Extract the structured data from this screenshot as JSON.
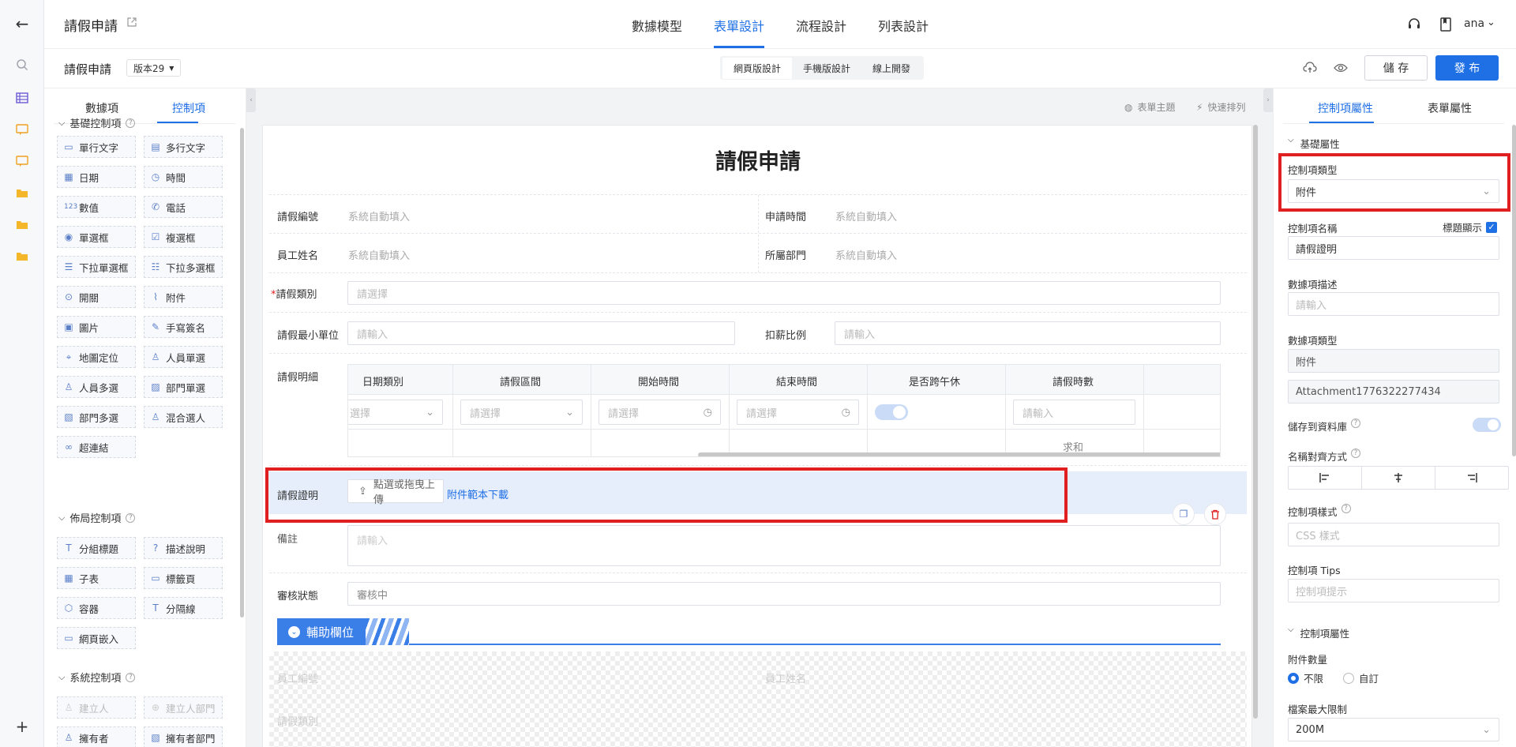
{
  "header": {
    "title": "請假申請",
    "tabs": [
      {
        "label": "數據模型"
      },
      {
        "label": "表單設計"
      },
      {
        "label": "流程設計"
      },
      {
        "label": "列表設計"
      }
    ],
    "user": "ana"
  },
  "subbar": {
    "form_name": "請假申請",
    "version": "版本29",
    "modes": [
      "網頁版設計",
      "手機版設計",
      "線上開發"
    ],
    "save": "儲 存",
    "publish": "發 布"
  },
  "left_panel": {
    "tabs": [
      "數據項",
      "控制項"
    ],
    "basic": {
      "title": "基礎控制項",
      "items": [
        "單行文字",
        "多行文字",
        "日期",
        "時間",
        "數值",
        "電話",
        "單選框",
        "複選框",
        "下拉單選框",
        "下拉多選框",
        "開關",
        "附件",
        "圖片",
        "手寫簽名",
        "地圖定位",
        "人員單選",
        "人員多選",
        "部門單選",
        "部門多選",
        "混合選人",
        "超連結"
      ]
    },
    "layout": {
      "title": "佈局控制項",
      "items": [
        "分組標題",
        "描述說明",
        "子表",
        "標籤頁",
        "容器",
        "分隔線",
        "網頁嵌入"
      ]
    },
    "system": {
      "title": "系統控制項",
      "items": [
        "建立人",
        "建立人部門",
        "擁有者",
        "擁有者部門"
      ]
    }
  },
  "canvas": {
    "toolbar": {
      "theme": "表單主題",
      "arrange": "快速排列"
    },
    "form_title": "請假申請",
    "auto_fill": "系統自動填入",
    "fields": {
      "leave_no": "請假編號",
      "apply_time": "申請時間",
      "employee_name": "員工姓名",
      "department": "所屬部門",
      "leave_type": "請假類別",
      "min_unit": "請假最小單位",
      "deduct_ratio": "扣薪比例",
      "leave_detail": "請假明細",
      "proof": "請假證明",
      "remark": "備註",
      "review_status": "審核狀態"
    },
    "placeholders": {
      "select": "請選擇",
      "input": "請輸入",
      "select_partial": "選擇"
    },
    "detail_table": {
      "columns": [
        "日期類別",
        "請假區間",
        "開始時間",
        "結束時間",
        "是否跨午休",
        "請假時數"
      ],
      "sum_label": "求和"
    },
    "upload": {
      "button": "點選或拖曳上傳",
      "template_link": "附件範本下載"
    },
    "review_value": "審核中",
    "aux_section": "輔助欄位",
    "aux_fields": {
      "employee_no": "員工編號",
      "employee_name": "員工姓名",
      "leave_type": "請假類別"
    }
  },
  "right_panel": {
    "tabs": [
      "控制項屬性",
      "表單屬性"
    ],
    "basic_attrs": "基礎屬性",
    "control_type_label": "控制項類型",
    "control_type_value": "附件",
    "control_name_label": "控制項名稱",
    "title_display": "標題顯示",
    "control_name_value": "請假證明",
    "data_desc_label": "數據項描述",
    "data_desc_placeholder": "請輸入",
    "data_type_label": "數據項類型",
    "data_type_value": "附件",
    "data_id": "Attachment1776322277434",
    "store_db_label": "儲存到資料庫",
    "name_align_label": "名稱對齊方式",
    "style_label": "控制項樣式",
    "style_placeholder": "CSS 樣式",
    "tips_label": "控制項 Tips",
    "tips_placeholder": "控制項提示",
    "control_attrs": "控制項屬性",
    "attach_count_label": "附件數量",
    "unlimited": "不限",
    "custom": "自訂",
    "max_size_label": "檔案最大限制",
    "max_size_value": "200M"
  },
  "colors": {
    "accent": "#1f6fe5",
    "highlight": "#e02020"
  }
}
